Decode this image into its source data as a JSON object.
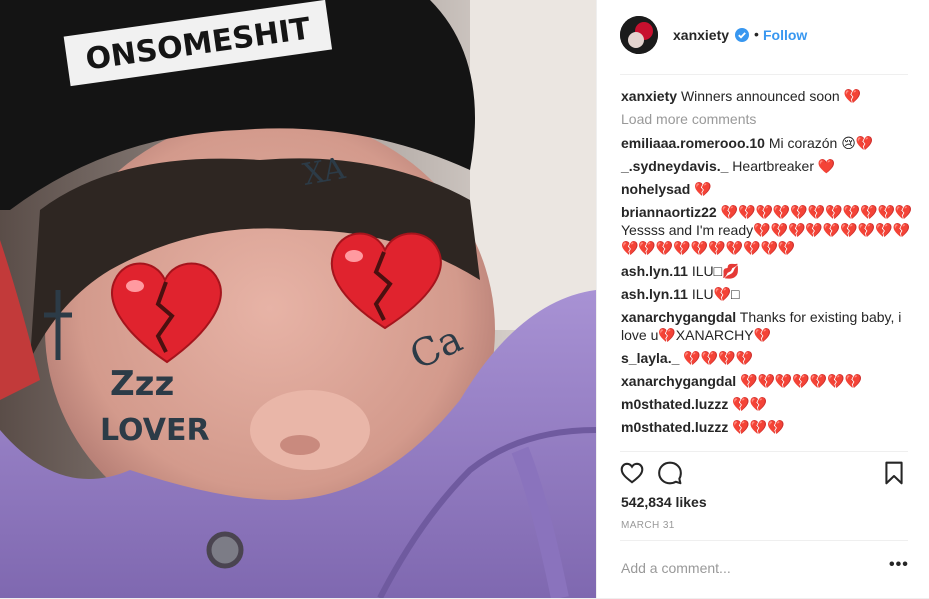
{
  "post": {
    "username": "xanxiety",
    "follow_label": "Follow",
    "dot": "•",
    "image": {
      "beanie_text": "ONSOMESHIT",
      "face_tattoo_text": "Zzz\nLOVER"
    },
    "caption": {
      "user": "xanxiety",
      "text": "Winners announced soon 💔"
    },
    "load_more": "Load more comments",
    "comments": [
      {
        "user": "emiliaaa.romerooo.10",
        "text": "Mi corazón 😢💔"
      },
      {
        "user": "_.sydneydavis._",
        "text": "Heartbreaker ❤️"
      },
      {
        "user": "nohelysad",
        "text": "💔"
      },
      {
        "user": "briannaortiz22",
        "text": "💔💔💔💔💔💔💔💔💔💔💔Yessss and I'm ready💔💔💔💔💔💔💔💔💔💔💔💔💔💔💔💔💔💔💔"
      },
      {
        "user": "ash.lyn.11",
        "text": "ILU□💋"
      },
      {
        "user": "ash.lyn.11",
        "text": "ILU💔□"
      },
      {
        "user": "xanarchygangdal",
        "text": "Thanks for existing baby, i love u💔XANARCHY💔"
      },
      {
        "user": "s_layla._",
        "text": "💔💔💔💔"
      },
      {
        "user": "xanarchygangdal",
        "text": "💔💔💔💔💔💔💔"
      },
      {
        "user": "m0sthated.luzzz",
        "text": "💔💔"
      },
      {
        "user": "m0sthated.luzzz",
        "text": "💔💔💔"
      }
    ],
    "likes": "542,834 likes",
    "date": "MARCH 31",
    "add_comment_placeholder": "Add a comment...",
    "more_label": "•••"
  },
  "colors": {
    "link": "#3897f0",
    "muted": "#999999",
    "text": "#262626",
    "heart": "#d4142d",
    "hoodie": "#9b84c8"
  },
  "icons": {
    "verified": "verified-badge-icon",
    "like": "heart-outline-icon",
    "comment": "speech-bubble-icon",
    "save": "bookmark-icon",
    "options": "more-options-icon"
  }
}
